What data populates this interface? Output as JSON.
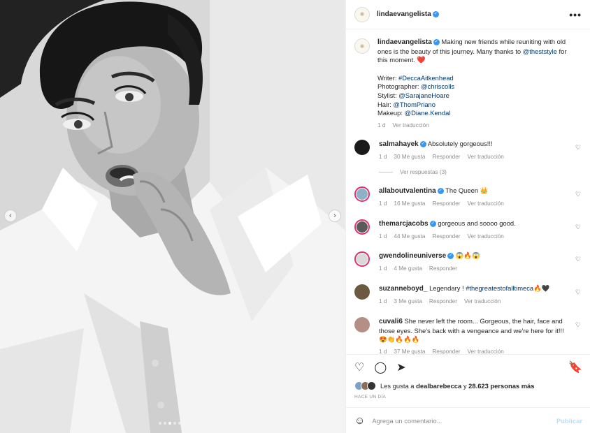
{
  "post": {
    "username": "lindaevangelista",
    "avatar_glyph": "✺",
    "more_icon": "more-horizontal-icon",
    "more_glyph": "•••",
    "caption": {
      "text": "Making new friends while reuniting with old ones is the beauty of this journey. Many thanks to",
      "mention": "@theststyle",
      "text_end": "for this moment.",
      "heart": "❤️",
      "credits": [
        {
          "label": "Writer:",
          "value": "#DeccaAitkenhead"
        },
        {
          "label": "Photographer:",
          "value": "@chriscolls"
        },
        {
          "label": "Stylist:",
          "value": "@SarajaneHoare"
        },
        {
          "label": "Hair:",
          "value": "@ThomPriano"
        },
        {
          "label": "Makeup:",
          "value": "@Diane.Kendal"
        }
      ],
      "time": "1 d",
      "translate": "Ver traducción"
    }
  },
  "comments": [
    {
      "user": "salmahayek",
      "verified": true,
      "text": "Absolutely gorgeous!!!",
      "time": "1 d",
      "likes": "30 Me gusta",
      "reply": "Responder",
      "translate": "Ver traducción",
      "avatar_color": "#1a1a1a"
    },
    {
      "user": "allaboutvalentina",
      "verified": true,
      "text": "The Queen 👑",
      "time": "1 d",
      "likes": "16 Me gusta",
      "reply": "Responder",
      "translate": "Ver traducción",
      "avatar_color": "#8fb0c9"
    },
    {
      "user": "themarcjacobs",
      "verified": true,
      "text": "gorgeous and soooo good.",
      "time": "1 d",
      "likes": "44 Me gusta",
      "reply": "Responder",
      "translate": "Ver traducción",
      "avatar_color": "#5a5a5a"
    },
    {
      "user": "gwendolineuniverse",
      "verified": true,
      "text": "😱🔥😱",
      "time": "1 d",
      "likes": "4 Me gusta",
      "reply": "Responder",
      "translate": "",
      "avatar_color": "#d9d9d9"
    },
    {
      "user": "suzanneboyd_",
      "verified": false,
      "text": "Legendary ! ",
      "hashtag": "#thegreatestofalltimeca",
      "emoji": "🔥🖤",
      "time": "1 d",
      "likes": "3 Me gusta",
      "reply": "Responder",
      "translate": "Ver traducción",
      "avatar_color": "#6b5a40"
    },
    {
      "user": "cuvali6",
      "verified": false,
      "text": "She never left the room... Gorgeous, the hair, face and those eyes. She's back with a vengeance and we're here for it!!! 😍👏🔥🔥🔥",
      "time": "1 d",
      "likes": "37 Me gusta",
      "reply": "Responder",
      "translate": "Ver traducción",
      "avatar_color": "#b48f86"
    }
  ],
  "view_replies": "Ver respuestas (3)",
  "icons": {
    "heart": "♡",
    "comment": "◯",
    "share": "➤",
    "save": "🔖",
    "emoji": "☺"
  },
  "likes": {
    "prefix": "Les gusta a",
    "user": "dealbarebecca",
    "middle": "y",
    "count": "28.623 personas más"
  },
  "time_ago": "HACE UN DÍA",
  "comment_input": {
    "placeholder": "Agrega un comentario...",
    "publish": "Publicar"
  },
  "carousel": {
    "prev": "‹",
    "next": "›",
    "dots": 5,
    "active_dot": 2
  }
}
